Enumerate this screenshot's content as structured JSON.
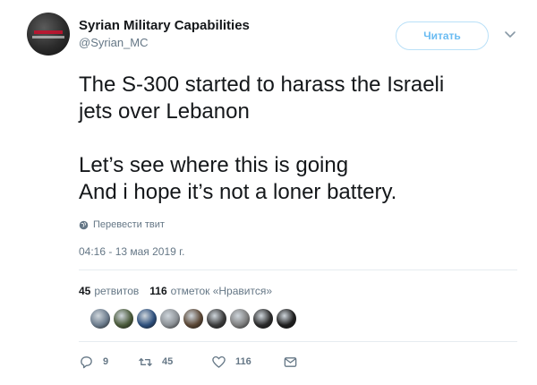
{
  "author": {
    "name": "Syrian Military Capabilities",
    "handle": "@Syrian_MC"
  },
  "follow_button_label": "Читать",
  "tweet_text": "The S-300 started to harass the Israeli\njets over Lebanon\n\nLet’s see where this is going\nAnd i hope it’s not a loner battery.",
  "translate_label": "Перевести твит",
  "timestamp": "04:16 - 13 мая 2019 г.",
  "stats": {
    "retweets_count": "45",
    "retweets_label": "ретвитов",
    "likes_count": "116",
    "likes_label": "отметок «Нравится»"
  },
  "liker_avatars": [
    {
      "name": "liker-avatar-1",
      "color": "#6b7b8c"
    },
    {
      "name": "liker-avatar-2",
      "color": "#4a5a3a"
    },
    {
      "name": "liker-avatar-3",
      "color": "#2d4f7c"
    },
    {
      "name": "liker-avatar-4",
      "color": "#8a8f94"
    },
    {
      "name": "liker-avatar-5",
      "color": "#5a4634"
    },
    {
      "name": "liker-avatar-6",
      "color": "#3a3a3a"
    },
    {
      "name": "liker-avatar-7",
      "color": "#7d7d7d"
    },
    {
      "name": "liker-avatar-8",
      "color": "#2a2a2a"
    },
    {
      "name": "liker-avatar-9",
      "color": "#1e1e1e"
    }
  ],
  "actions": {
    "reply_count": "9",
    "retweet_count": "45",
    "like_count": "116"
  },
  "colors": {
    "accent": "#1da1f2",
    "muted": "#657786",
    "text": "#14171a"
  }
}
